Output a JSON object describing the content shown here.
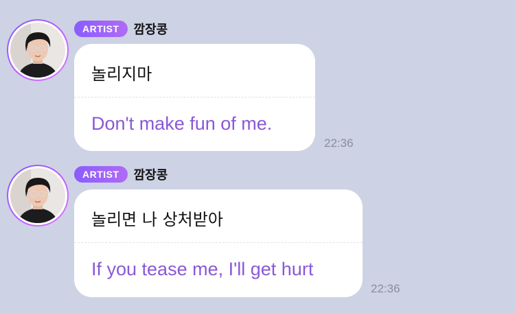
{
  "colors": {
    "background": "#cdd2e4",
    "bubble": "#ffffff",
    "badge_gradient_start": "#8a5cff",
    "badge_gradient_end": "#b06bf5",
    "translation_text": "#8a58d6",
    "timestamp_text": "#8a8d9a",
    "avatar_ring_start": "#7b5cff",
    "avatar_ring_end": "#d77cff"
  },
  "messages": [
    {
      "badge": "ARTIST",
      "sender": "깜장콩",
      "original": "놀리지마",
      "translation": "Don't make fun of me.",
      "time": "22:36",
      "avatar_icon": "artist-profile-photo"
    },
    {
      "badge": "ARTIST",
      "sender": "깜장콩",
      "original": "놀리면 나 상처받아",
      "translation": "If you tease me, I'll get hurt",
      "time": "22:36",
      "avatar_icon": "artist-profile-photo"
    }
  ]
}
